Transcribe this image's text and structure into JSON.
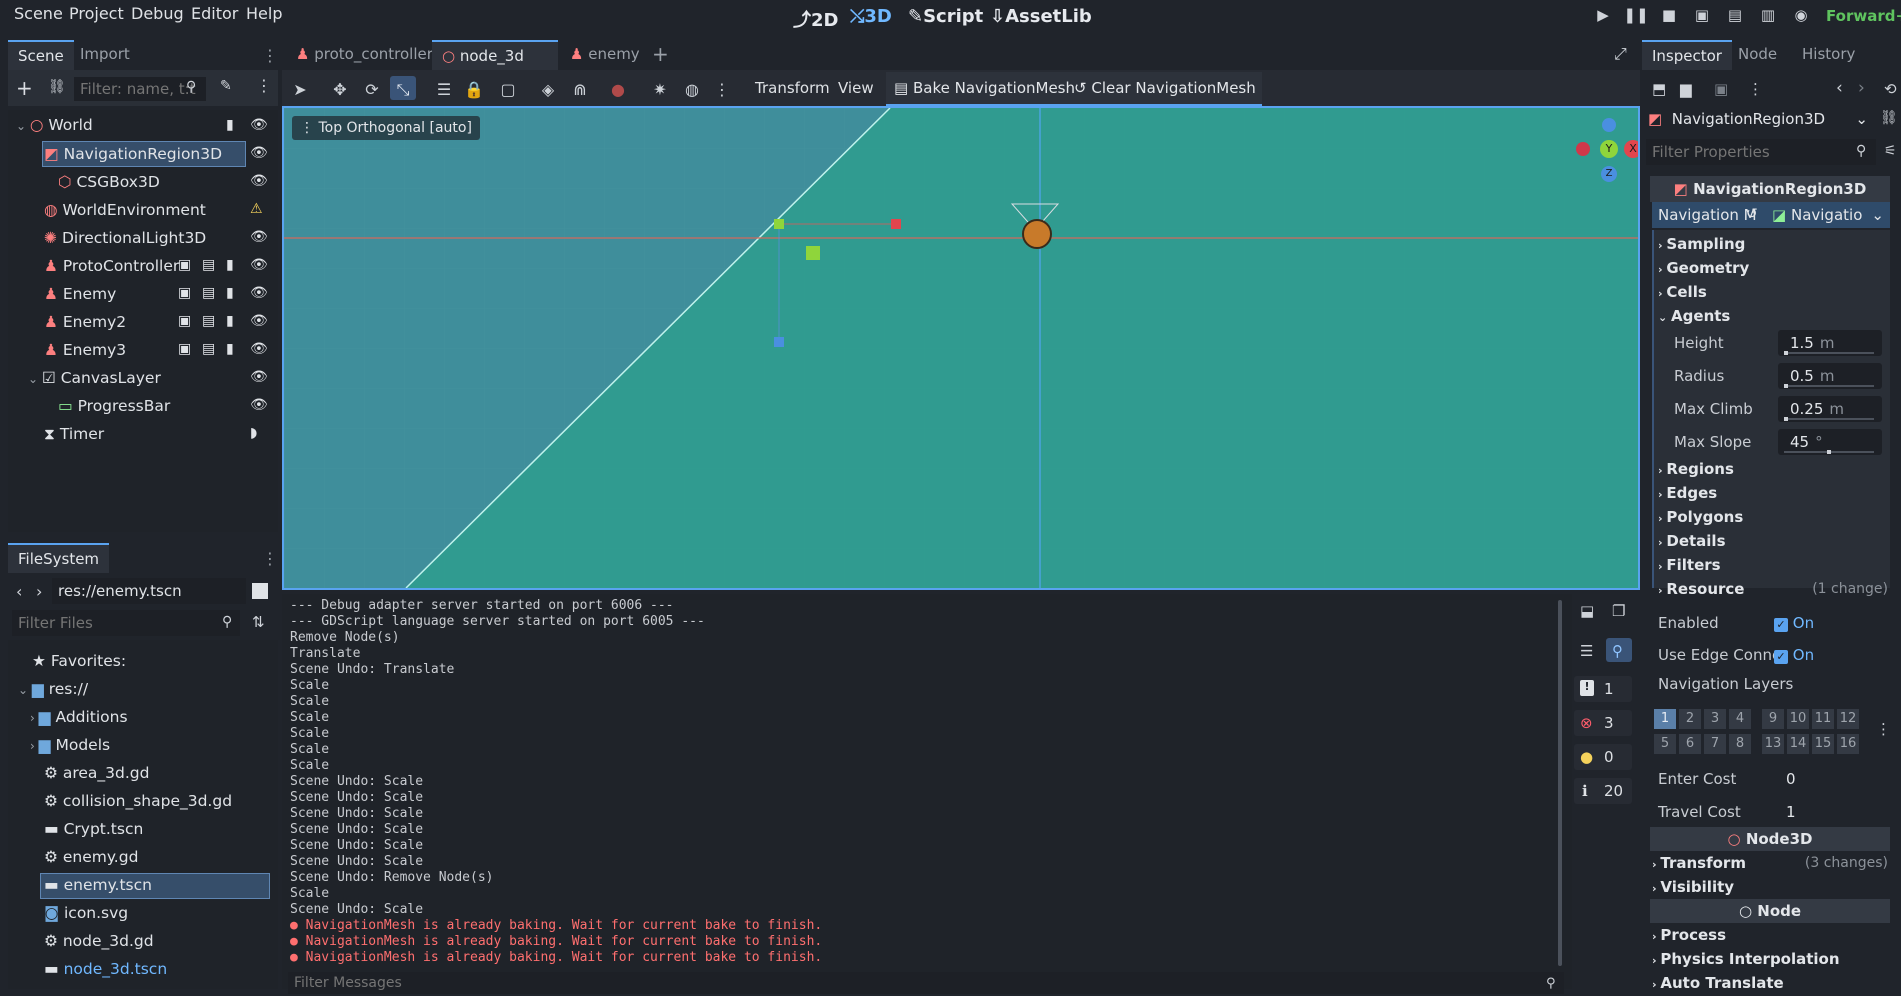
{
  "menubar": {
    "items": [
      "Scene",
      "Project",
      "Debug",
      "Editor",
      "Help"
    ],
    "modes": [
      "2D",
      "3D",
      "Script",
      "AssetLib"
    ],
    "active_mode": "3D",
    "renderer": "Forward+"
  },
  "scene_dock": {
    "tabs": [
      "Scene",
      "Import"
    ],
    "filter_placeholder": "Filter: name, t:t",
    "tree": [
      {
        "label": "World",
        "icon": "node3d-icon"
      },
      {
        "label": "NavigationRegion3D",
        "icon": "navigation-region-icon"
      },
      {
        "label": "CSGBox3D",
        "icon": "csgbox-icon"
      },
      {
        "label": "WorldEnvironment",
        "icon": "world-environment-icon"
      },
      {
        "label": "DirectionalLight3D",
        "icon": "light-icon"
      },
      {
        "label": "ProtoController",
        "icon": "character-icon"
      },
      {
        "label": "Enemy",
        "icon": "character-icon"
      },
      {
        "label": "Enemy2",
        "icon": "character-icon"
      },
      {
        "label": "Enemy3",
        "icon": "character-icon"
      },
      {
        "label": "CanvasLayer",
        "icon": "canvas-layer-icon"
      },
      {
        "label": "ProgressBar",
        "icon": "progressbar-icon"
      },
      {
        "label": "Timer",
        "icon": "timer-icon"
      }
    ]
  },
  "filesystem": {
    "tab": "FileSystem",
    "path": "res://enemy.tscn",
    "filter_placeholder": "Filter Files",
    "items": [
      {
        "label": "Favorites:",
        "icon": "star-icon"
      },
      {
        "label": "res://",
        "icon": "folder-icon"
      },
      {
        "label": "Additions",
        "icon": "folder-icon"
      },
      {
        "label": "Models",
        "icon": "folder-icon"
      },
      {
        "label": "area_3d.gd",
        "icon": "gear-icon"
      },
      {
        "label": "collision_shape_3d.gd",
        "icon": "gear-icon"
      },
      {
        "label": "Crypt.tscn",
        "icon": "clapper-icon"
      },
      {
        "label": "enemy.gd",
        "icon": "gear-icon"
      },
      {
        "label": "enemy.tscn",
        "icon": "clapper-icon"
      },
      {
        "label": "icon.svg",
        "icon": "image-icon"
      },
      {
        "label": "node_3d.gd",
        "icon": "gear-icon"
      },
      {
        "label": "node_3d.tscn",
        "icon": "clapper-icon"
      }
    ]
  },
  "editor_tabs": [
    "proto_controller",
    "node_3d",
    "enemy"
  ],
  "viewport_toolbar": {
    "menus": [
      "Transform",
      "View"
    ],
    "bake": "Bake NavigationMesh",
    "clear": "Clear NavigationMesh"
  },
  "viewport": {
    "label": "Top Orthogonal [auto]",
    "gizmo_labels": [
      "Y",
      "X",
      "Z"
    ]
  },
  "console": {
    "lines": [
      "--- Debug adapter server started on port 6006 ---",
      "--- GDScript language server started on port 6005 ---",
      "Remove Node(s)",
      "Translate",
      "Scene Undo: Translate",
      "Scale",
      "Scale",
      "Scale",
      "Scale",
      "Scale",
      "Scale",
      "Scene Undo: Scale",
      "Scene Undo: Scale",
      "Scene Undo: Scale",
      "Scene Undo: Scale",
      "Scene Undo: Scale",
      "Scene Undo: Scale",
      "Scene Undo: Remove Node(s)",
      "Scale",
      "Scene Undo: Scale"
    ],
    "errors": [
      "NavigationMesh is already baking. Wait for current bake to finish.",
      "NavigationMesh is already baking. Wait for current bake to finish.",
      "NavigationMesh is already baking. Wait for current bake to finish."
    ],
    "filter_placeholder": "Filter Messages",
    "counts": {
      "messages": "1",
      "errors": "3",
      "warnings": "0",
      "info": "20"
    }
  },
  "inspector": {
    "tabs": [
      "Inspector",
      "Node",
      "History"
    ],
    "object": "NavigationRegion3D",
    "filter_placeholder": "Filter Properties",
    "class_header": "NavigationRegion3D",
    "navmesh_label": "Navigation M",
    "navmesh_resource": "Navigatio",
    "sections": [
      "Sampling",
      "Geometry",
      "Cells",
      "Agents"
    ],
    "agents": [
      {
        "label": "Height",
        "value": "1.5",
        "unit": "m",
        "level": 0.0
      },
      {
        "label": "Radius",
        "value": "0.5",
        "unit": "m",
        "level": 0.0
      },
      {
        "label": "Max Climb",
        "value": "0.25",
        "unit": "m",
        "level": 0.0
      },
      {
        "label": "Max Slope",
        "value": "45",
        "unit": "°",
        "level": 0.5
      }
    ],
    "sections_after": [
      "Regions",
      "Edges",
      "Polygons",
      "Details",
      "Filters"
    ],
    "resource": {
      "label": "Resource",
      "note": "(1 change)"
    },
    "enabled": {
      "label": "Enabled",
      "value": "On"
    },
    "use_edge": {
      "label": "Use Edge Conne",
      "value": "On"
    },
    "nav_layers_label": "Navigation Layers",
    "layers_top": [
      "1",
      "2",
      "3",
      "4",
      "9",
      "10",
      "11",
      "12"
    ],
    "layers_bottom": [
      "5",
      "6",
      "7",
      "8",
      "13",
      "14",
      "15",
      "16"
    ],
    "enter_cost": {
      "label": "Enter Cost",
      "value": "0"
    },
    "travel_cost": {
      "label": "Travel Cost",
      "value": "1"
    },
    "node3d_header": "Node3D",
    "transform": {
      "label": "Transform",
      "note": "(3 changes)"
    },
    "visibility": "Visibility",
    "node_header": "Node",
    "node_sections": [
      "Process",
      "Physics Interpolation",
      "Auto Translate"
    ]
  },
  "colors": {
    "accent": "#5aa3f0",
    "background": "#20242b",
    "panel": "#272b33",
    "navmesh": "#2e9e8e",
    "error": "#ff6f6f"
  }
}
